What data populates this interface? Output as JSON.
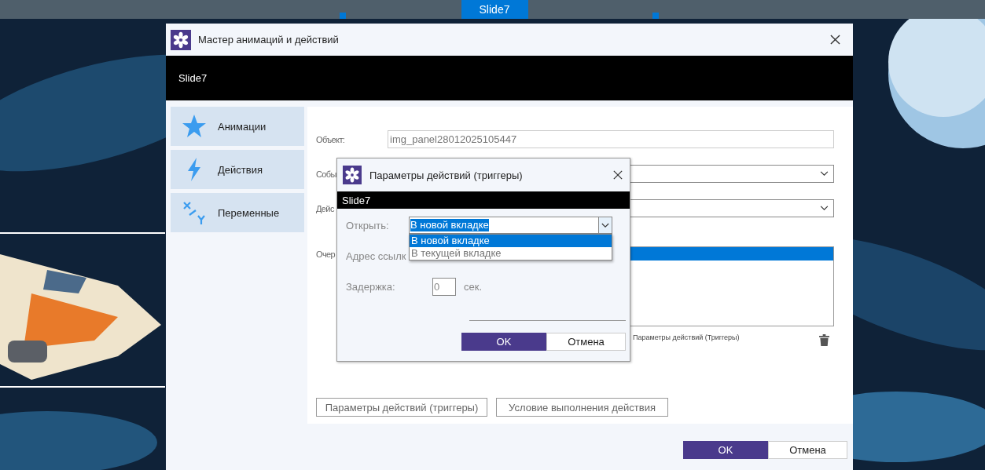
{
  "editor": {
    "slide_tab": "Slide7"
  },
  "wizard": {
    "title": "Мастер анимаций и действий",
    "banner": "Slide7",
    "nav": [
      {
        "label": "Анимации",
        "kind": "star"
      },
      {
        "label": "Действия",
        "kind": "bolt"
      },
      {
        "label": "Переменные",
        "kind": "variable"
      }
    ],
    "fields": [
      {
        "label": "Объект:",
        "kind": "text",
        "value": "img_panel28012025105447"
      },
      {
        "label": "Собы",
        "kind": "select"
      },
      {
        "label": "Дейс",
        "kind": "select"
      }
    ],
    "queue": {
      "label": "Очер",
      "rows": [
        {
          "selected": true
        }
      ],
      "caption": "Параметры действий (Триггеры)"
    },
    "action_buttons": [
      "Параметры действий (триггеры)",
      "Условие выполнения действия"
    ],
    "ok": "OK",
    "cancel": "Отмена"
  },
  "popup": {
    "title": "Параметры действий (триггеры)",
    "banner": "Slide7",
    "open": {
      "label": "Открыть:",
      "value": "В новой вкладке",
      "expanded": true,
      "options": [
        {
          "label": "В новой вкладке",
          "selected": true
        },
        {
          "label": "В текущей вкладке",
          "selected": false
        }
      ]
    },
    "address_label": "Адрес ссылк",
    "delay": {
      "label": "Задержка:",
      "value": "0",
      "unit": "сек."
    },
    "ok": "OK",
    "cancel": "Отмена"
  }
}
